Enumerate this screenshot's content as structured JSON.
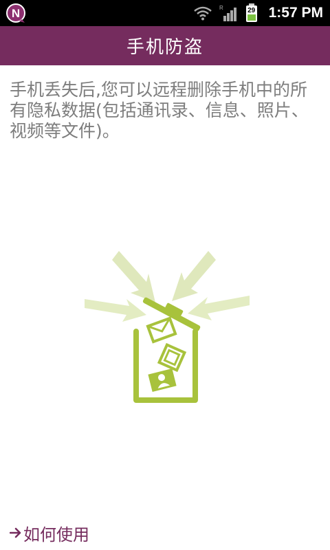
{
  "status_bar": {
    "app_icon": "n-logo-icon",
    "wifi_icon": "wifi-icon",
    "roaming_indicator": "R",
    "signal_icon": "signal-icon",
    "battery_icon": "battery-icon",
    "battery_level": "29",
    "time": "1:57 PM"
  },
  "header": {
    "title": "手机防盗"
  },
  "main": {
    "description": "手机丢失后,您可以远程删除手机中的所有隐私数据(包括通讯录、信息、照片、视频等文件)。",
    "illustration": "trash-bin-icon"
  },
  "footer": {
    "how_to_link": "如何使用"
  },
  "colors": {
    "accent": "#752c5e",
    "illustration_green": "#a8c23c",
    "status_bar": "#000000",
    "text_gray": "#7d7d7d"
  }
}
